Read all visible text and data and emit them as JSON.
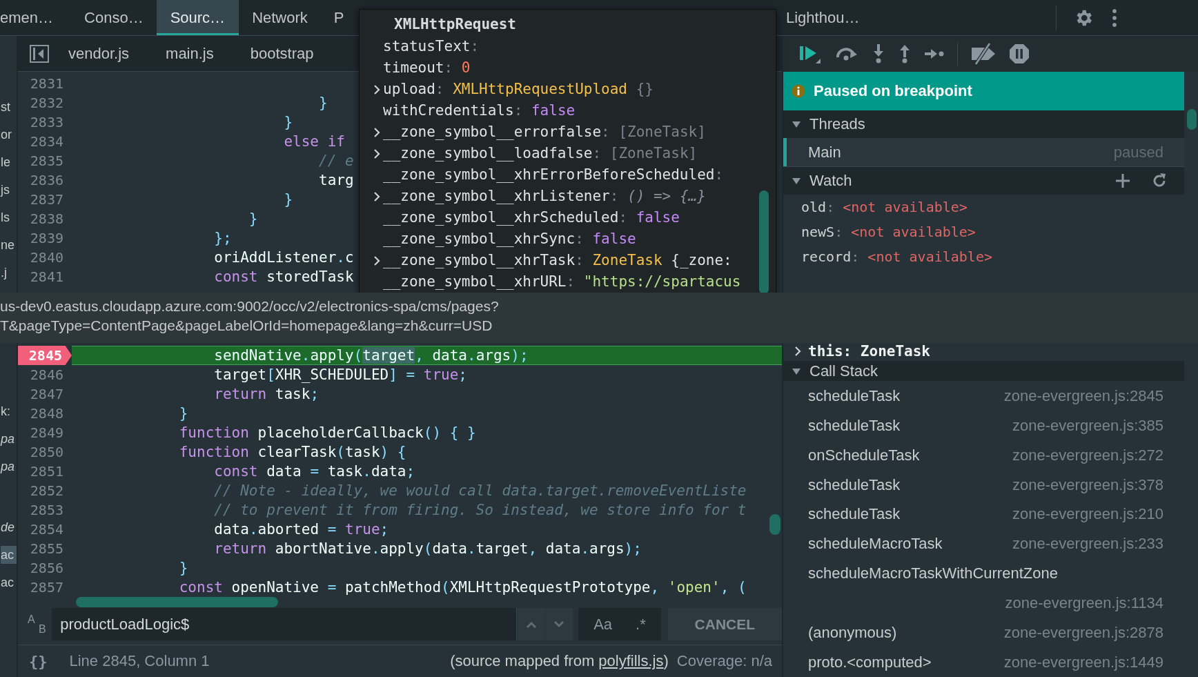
{
  "tabs": [
    {
      "label": "emen…",
      "selected": false
    },
    {
      "label": "Conso…",
      "selected": false
    },
    {
      "label": "Sourc…",
      "selected": true
    },
    {
      "label": "Network",
      "selected": false
    },
    {
      "label": "P",
      "selected": false
    }
  ],
  "tabs_right": [
    {
      "label": "Lighthou…",
      "selected": false
    }
  ],
  "navigator": {
    "upper": [
      {
        "text": "st",
        "italic": false,
        "selected": false
      },
      {
        "text": "or",
        "italic": false,
        "selected": false
      },
      {
        "text": "le",
        "italic": false,
        "selected": false
      },
      {
        "text": "js",
        "italic": false,
        "selected": false
      },
      {
        "text": "ls",
        "italic": false,
        "selected": false
      },
      {
        "text": "ne",
        "italic": false,
        "selected": false
      },
      {
        "text": ".j",
        "italic": false,
        "selected": false
      }
    ],
    "lower_a": [
      {
        "text": "k:",
        "italic": false,
        "selected": false
      },
      {
        "text": "pa",
        "italic": true,
        "selected": false
      },
      {
        "text": "pa",
        "italic": true,
        "selected": false
      }
    ],
    "lower_b": [
      {
        "text": "de",
        "italic": true,
        "selected": false
      },
      {
        "text": "ac",
        "italic": false,
        "selected": true
      },
      {
        "text": "ac",
        "italic": false,
        "selected": false
      }
    ]
  },
  "file_tabs": [
    {
      "label": "vendor.js",
      "selected": false
    },
    {
      "label": "main.js",
      "selected": false
    },
    {
      "label": "bootstrap",
      "selected": false
    }
  ],
  "code_upper": [
    {
      "n": "2831",
      "breakpoint": false,
      "current": false
    },
    {
      "n": "2832",
      "breakpoint": false,
      "current": false,
      "tokens": [
        {
          "text": "                            }",
          "kind": "punct"
        }
      ]
    },
    {
      "n": "2833",
      "breakpoint": false,
      "current": false,
      "tokens": [
        {
          "text": "                        }",
          "kind": "punct"
        }
      ]
    },
    {
      "n": "2834",
      "breakpoint": false,
      "current": false,
      "tokens": [
        {
          "text": "                        else if",
          "kind": "kw"
        }
      ]
    },
    {
      "n": "2835",
      "breakpoint": false,
      "current": false,
      "tokens": [
        {
          "text": "                            // e",
          "kind": "comment"
        }
      ]
    },
    {
      "n": "2836",
      "breakpoint": false,
      "current": false,
      "tokens": [
        {
          "text": "                            targ",
          "kind": "id"
        }
      ]
    },
    {
      "n": "2837",
      "breakpoint": false,
      "current": false,
      "tokens": [
        {
          "text": "                        }",
          "kind": "punct"
        }
      ]
    },
    {
      "n": "2838",
      "breakpoint": false,
      "current": false,
      "tokens": [
        {
          "text": "                    }",
          "kind": "punct"
        }
      ]
    },
    {
      "n": "2839",
      "breakpoint": false,
      "current": false,
      "tokens": [
        {
          "text": "                };",
          "kind": "punct"
        }
      ]
    },
    {
      "n": "2840",
      "breakpoint": false,
      "current": false,
      "tokens": [
        {
          "text": "                oriAddListener",
          "kind": "id"
        },
        {
          "text": ".",
          "kind": "punct"
        },
        {
          "text": "c",
          "kind": "id"
        }
      ]
    },
    {
      "n": "2841",
      "breakpoint": false,
      "current": false,
      "tokens": [
        {
          "text": "                const",
          "kind": "kw"
        },
        {
          "text": " storedTask",
          "kind": "id"
        }
      ]
    }
  ],
  "popover": {
    "title": "XMLHttpRequest",
    "items": [
      {
        "key": "statusText",
        "sep": ":",
        "expandable": false,
        "value": []
      },
      {
        "key": "timeout",
        "sep": ":",
        "expandable": false,
        "value": [
          {
            "text": "0",
            "kind": "num"
          }
        ]
      },
      {
        "key": "upload",
        "sep": ":",
        "expandable": true,
        "value": [
          {
            "text": "XMLHttpRequestUpload",
            "kind": "obj"
          },
          {
            "text": " {}",
            "kind": "dim"
          }
        ]
      },
      {
        "key": "withCredentials",
        "sep": ":",
        "expandable": false,
        "value": [
          {
            "text": "false",
            "kind": "bool"
          }
        ]
      },
      {
        "key": "__zone_symbol__errorfalse",
        "sep": ":",
        "expandable": true,
        "value": [
          {
            "text": "[ZoneTask]",
            "kind": "dim"
          }
        ]
      },
      {
        "key": "__zone_symbol__loadfalse",
        "sep": ":",
        "expandable": true,
        "value": [
          {
            "text": "[ZoneTask]",
            "kind": "dim"
          }
        ]
      },
      {
        "key": "__zone_symbol__xhrErrorBeforeScheduled",
        "sep": ":",
        "expandable": false,
        "value": []
      },
      {
        "key": "__zone_symbol__xhrListener",
        "sep": ":",
        "expandable": true,
        "value": [
          {
            "text": "() => {…}",
            "kind": "fn"
          }
        ]
      },
      {
        "key": "__zone_symbol__xhrScheduled",
        "sep": ":",
        "expandable": false,
        "value": [
          {
            "text": "false",
            "kind": "bool"
          }
        ]
      },
      {
        "key": "__zone_symbol__xhrSync",
        "sep": ":",
        "expandable": false,
        "value": [
          {
            "text": "false",
            "kind": "bool"
          }
        ]
      },
      {
        "key": "__zone_symbol__xhrTask",
        "sep": ":",
        "expandable": true,
        "value": [
          {
            "text": "ZoneTask",
            "kind": "obj"
          },
          {
            "text": " {_zone:",
            "kind": "plain"
          }
        ]
      },
      {
        "key": "__zone_symbol__xhrURL",
        "sep": ":",
        "expandable": false,
        "value": [
          {
            "text": "\"https://spartacus",
            "kind": "str"
          }
        ]
      }
    ]
  },
  "debug_buttons": [
    {
      "kind": "resume"
    },
    {
      "kind": "step-over"
    },
    {
      "kind": "step-into"
    },
    {
      "kind": "step-out"
    },
    {
      "kind": "step"
    },
    {
      "kind": "deactivate"
    },
    {
      "kind": "pause-exceptions"
    }
  ],
  "banner": {
    "text": "Paused on breakpoint"
  },
  "threads": {
    "title": "Threads",
    "expanded": true,
    "items": [
      {
        "name": "Main",
        "status": "paused",
        "selected": true
      }
    ]
  },
  "watch": {
    "title": "Watch",
    "expanded": true,
    "items": [
      {
        "name": "old",
        "sep": ":",
        "value": "<not available>"
      },
      {
        "name": "newS",
        "sep": ":",
        "value": "<not available>"
      },
      {
        "name": "record",
        "sep": ":",
        "value": "<not available>"
      }
    ]
  },
  "url_tooltip": {
    "lines": [
      "us-dev0.eastus.cloudapp.azure.com:9002/occ/v2/electronics-spa/cms/pages?",
      "T&pageType=ContentPage&pageLabelOrId=homepage&lang=zh&curr=USD"
    ]
  },
  "code_lower": [
    {
      "n": "2845",
      "breakpoint": true,
      "current": true,
      "tokens": [
        {
          "text": "                sendNative",
          "kind": "id"
        },
        {
          "text": ".",
          "kind": "punct"
        },
        {
          "text": "apply",
          "kind": "id"
        },
        {
          "text": "(",
          "kind": "punct"
        },
        {
          "text": "target",
          "kind": "hl"
        },
        {
          "text": ",",
          "kind": "punct"
        },
        {
          "text": " data",
          "kind": "id"
        },
        {
          "text": ".",
          "kind": "punct"
        },
        {
          "text": "args",
          "kind": "id"
        },
        {
          "text": ");",
          "kind": "punct"
        }
      ]
    },
    {
      "n": "2846",
      "breakpoint": false,
      "current": false,
      "tokens": [
        {
          "text": "                target",
          "kind": "id"
        },
        {
          "text": "[",
          "kind": "punct"
        },
        {
          "text": "XHR_SCHEDULED",
          "kind": "id"
        },
        {
          "text": "] = ",
          "kind": "punct"
        },
        {
          "text": "true",
          "kind": "kw"
        },
        {
          "text": ";",
          "kind": "punct"
        }
      ]
    },
    {
      "n": "2847",
      "breakpoint": false,
      "current": false,
      "tokens": [
        {
          "text": "                return",
          "kind": "kw"
        },
        {
          "text": " task",
          "kind": "id"
        },
        {
          "text": ";",
          "kind": "punct"
        }
      ]
    },
    {
      "n": "2848",
      "breakpoint": false,
      "current": false,
      "tokens": [
        {
          "text": "            }",
          "kind": "punct"
        }
      ]
    },
    {
      "n": "2849",
      "breakpoint": false,
      "current": false,
      "tokens": [
        {
          "text": "            function",
          "kind": "kw"
        },
        {
          "text": " placeholderCallback",
          "kind": "id"
        },
        {
          "text": "() { }",
          "kind": "punct"
        }
      ]
    },
    {
      "n": "2850",
      "breakpoint": false,
      "current": false,
      "tokens": [
        {
          "text": "            function",
          "kind": "kw"
        },
        {
          "text": " clearTask",
          "kind": "id"
        },
        {
          "text": "(",
          "kind": "punct"
        },
        {
          "text": "task",
          "kind": "id"
        },
        {
          "text": ") {",
          "kind": "punct"
        }
      ]
    },
    {
      "n": "2851",
      "breakpoint": false,
      "current": false,
      "tokens": [
        {
          "text": "                const",
          "kind": "kw"
        },
        {
          "text": " data ",
          "kind": "id"
        },
        {
          "text": "=",
          "kind": "punct"
        },
        {
          "text": " task",
          "kind": "id"
        },
        {
          "text": ".",
          "kind": "punct"
        },
        {
          "text": "data",
          "kind": "id"
        },
        {
          "text": ";",
          "kind": "punct"
        }
      ]
    },
    {
      "n": "2852",
      "breakpoint": false,
      "current": false,
      "tokens": [
        {
          "text": "                // Note - ideally, we would call data.target.removeEventListe",
          "kind": "comment"
        }
      ]
    },
    {
      "n": "2853",
      "breakpoint": false,
      "current": false,
      "tokens": [
        {
          "text": "                // to prevent it from firing. So instead, we store info for t",
          "kind": "comment"
        }
      ]
    },
    {
      "n": "2854",
      "breakpoint": false,
      "current": false,
      "tokens": [
        {
          "text": "                data",
          "kind": "id"
        },
        {
          "text": ".",
          "kind": "punct"
        },
        {
          "text": "aborted",
          "kind": "id"
        },
        {
          "text": " = ",
          "kind": "punct"
        },
        {
          "text": "true",
          "kind": "kw"
        },
        {
          "text": ";",
          "kind": "punct"
        }
      ]
    },
    {
      "n": "2855",
      "breakpoint": false,
      "current": false,
      "tokens": [
        {
          "text": "                return",
          "kind": "kw"
        },
        {
          "text": " abortNative",
          "kind": "id"
        },
        {
          "text": ".",
          "kind": "punct"
        },
        {
          "text": "apply",
          "kind": "id"
        },
        {
          "text": "(",
          "kind": "punct"
        },
        {
          "text": "data",
          "kind": "id"
        },
        {
          "text": ".",
          "kind": "punct"
        },
        {
          "text": "target",
          "kind": "id"
        },
        {
          "text": ", ",
          "kind": "punct"
        },
        {
          "text": "data",
          "kind": "id"
        },
        {
          "text": ".",
          "kind": "punct"
        },
        {
          "text": "args",
          "kind": "id"
        },
        {
          "text": ");",
          "kind": "punct"
        }
      ]
    },
    {
      "n": "2856",
      "breakpoint": false,
      "current": false,
      "tokens": [
        {
          "text": "            }",
          "kind": "punct"
        }
      ]
    },
    {
      "n": "2857",
      "breakpoint": false,
      "current": false,
      "tokens": [
        {
          "text": "            const",
          "kind": "kw"
        },
        {
          "text": " openNative ",
          "kind": "id"
        },
        {
          "text": "=",
          "kind": "punct"
        },
        {
          "text": " patchMethod",
          "kind": "id"
        },
        {
          "text": "(",
          "kind": "punct"
        },
        {
          "text": "XMLHttpRequestPrototype",
          "kind": "id"
        },
        {
          "text": ", ",
          "kind": "punct"
        },
        {
          "text": "'open'",
          "kind": "str"
        },
        {
          "text": ", (",
          "kind": "punct"
        }
      ]
    }
  ],
  "search": {
    "replace_letters": [
      "A",
      "B"
    ],
    "value": "productLoadLogic$",
    "case_label": "Aa",
    "regex_label": ".*",
    "cancel_label": "CANCEL"
  },
  "status_bar": {
    "format_label": "{}",
    "position": "Line 2845, Column 1",
    "source_prefix": "(source mapped from ",
    "source_link": "polyfills.js",
    "source_suffix": ")",
    "coverage": "Coverage: n/a"
  },
  "scope": {
    "this_label": "this: ZoneTask",
    "expanded": false
  },
  "call_stack": {
    "title": "Call Stack",
    "expanded": true,
    "frames": [
      {
        "name": "scheduleTask",
        "file": "zone-evergreen.js:2845"
      },
      {
        "name": "scheduleTask",
        "file": "zone-evergreen.js:385"
      },
      {
        "name": "onScheduleTask",
        "file": "zone-evergreen.js:272"
      },
      {
        "name": "scheduleTask",
        "file": "zone-evergreen.js:378"
      },
      {
        "name": "scheduleTask",
        "file": "zone-evergreen.js:210"
      },
      {
        "name": "scheduleMacroTask",
        "file": "zone-evergreen.js:233"
      },
      {
        "name": "scheduleMacroTaskWithCurrentZone",
        "file": "zone-evergreen.js:1134"
      },
      {
        "name": "(anonymous)",
        "file": "zone-evergreen.js:2878"
      },
      {
        "name": "proto.<computed>",
        "file": "zone-evergreen.js:1449"
      }
    ]
  }
}
